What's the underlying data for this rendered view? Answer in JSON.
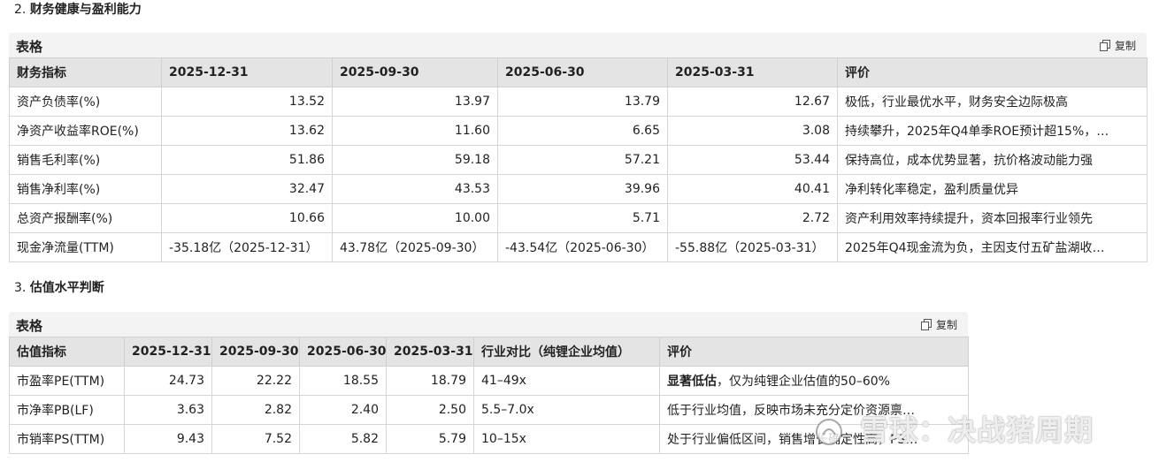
{
  "section2": {
    "number": "2.",
    "title": "财务健康与盈利能力",
    "card_label": "表格",
    "copy_label": "复制",
    "headers": [
      "财务指标",
      "2025-12-31",
      "2025-09-30",
      "2025-06-30",
      "2025-03-31",
      "评价"
    ],
    "rows": [
      [
        "资产负债率(%)",
        "13.52",
        "13.97",
        "13.79",
        "12.67",
        "极低，行业最优水平，财务安全边际极高"
      ],
      [
        "净资产收益率ROE(%)",
        "13.62",
        "11.60",
        "6.65",
        "3.08",
        "持续攀升，2025年Q4单季ROE预计超15%，…"
      ],
      [
        "销售毛利率(%)",
        "51.86",
        "59.18",
        "57.21",
        "53.44",
        "保持高位，成本优势显著，抗价格波动能力强"
      ],
      [
        "销售净利率(%)",
        "32.47",
        "43.53",
        "39.96",
        "40.41",
        "净利转化率稳定，盈利质量优异"
      ],
      [
        "总资产报酬率(%)",
        "10.66",
        "10.00",
        "5.71",
        "2.72",
        "资产利用效率持续提升，资本回报率行业领先"
      ],
      [
        "现金净流量(TTM)",
        "-35.18亿（2025-12-31）",
        "43.78亿（2025-09-30）",
        "-43.54亿（2025-06-30）",
        "-55.88亿（2025-03-31）",
        "2025年Q4现金流为负，主因支付五矿盐湖收…"
      ]
    ]
  },
  "section3": {
    "number": "3.",
    "title": "估值水平判断",
    "card_label": "表格",
    "copy_label": "复制",
    "headers": [
      "估值指标",
      "2025-12-31",
      "2025-09-30",
      "2025-06-30",
      "2025-03-31",
      "行业对比（纯锂企业均值）",
      "评价"
    ],
    "rows": [
      [
        "市盈率PE(TTM)",
        "24.73",
        "22.22",
        "18.55",
        "18.79",
        "41–49x",
        "显著低估",
        "，仅为纯锂企业估值的50–60%"
      ],
      [
        "市净率PB(LF)",
        "3.63",
        "2.82",
        "2.40",
        "2.50",
        "5.5–7.0x",
        "低于行业均值，反映市场未充分定价资源禀…",
        ""
      ],
      [
        "市销率PS(TTM)",
        "9.43",
        "7.52",
        "5.82",
        "5.79",
        "10–15x",
        "处于行业偏低区间，销售增长确定性高，PS…",
        ""
      ]
    ]
  },
  "watermark": {
    "text": "雪球：决战猪周期"
  }
}
